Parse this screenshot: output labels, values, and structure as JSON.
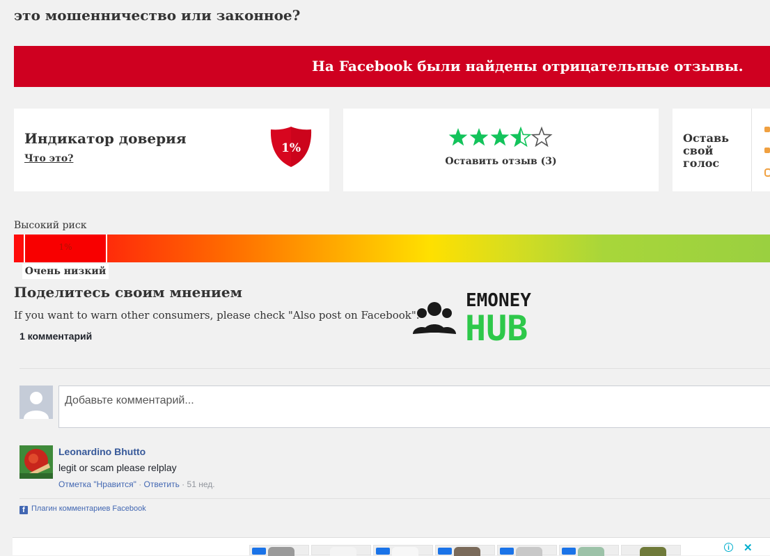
{
  "header": {
    "title": "это мошенничество или законное?"
  },
  "alert": {
    "text": "На Facebook были найдены отрицательные отзывы."
  },
  "trust_card": {
    "title": "Индикатор доверия",
    "link": "Что это?",
    "score": "1%"
  },
  "rating_card": {
    "rating": 3.5,
    "max": 5,
    "review_link": "Оставить отзыв (3)",
    "star_color": "#13c35b"
  },
  "vote_card": {
    "label": "Оставь свой голос"
  },
  "risk_scale": {
    "high_label": "Высокий риск",
    "marker_value": "1%",
    "marker_position": 0.01,
    "marker_label": "Очень низкий"
  },
  "share": {
    "heading": "Поделитесь своим мнением",
    "info": "If you want to warn other consumers, please check \"Also post on Facebook\"."
  },
  "logo": {
    "line1": "EMONEY",
    "line2": "HUB",
    "color1": "#1a1a1a",
    "color2": "#2ec84a"
  },
  "comments": {
    "count_label": "1 комментарий",
    "input_placeholder": "Добавьте комментарий...",
    "items": [
      {
        "author": "Leonardino Bhutto",
        "text": "legit or scam please relplay",
        "like": "Отметка \"Нравится\"",
        "sep": "·",
        "reply": "Ответить",
        "time": "51 нед."
      }
    ],
    "plugin_label": "Плагин комментариев Facebook"
  },
  "colors": {
    "alert_red": "#cf0020",
    "fb_blue": "#4267b2"
  }
}
